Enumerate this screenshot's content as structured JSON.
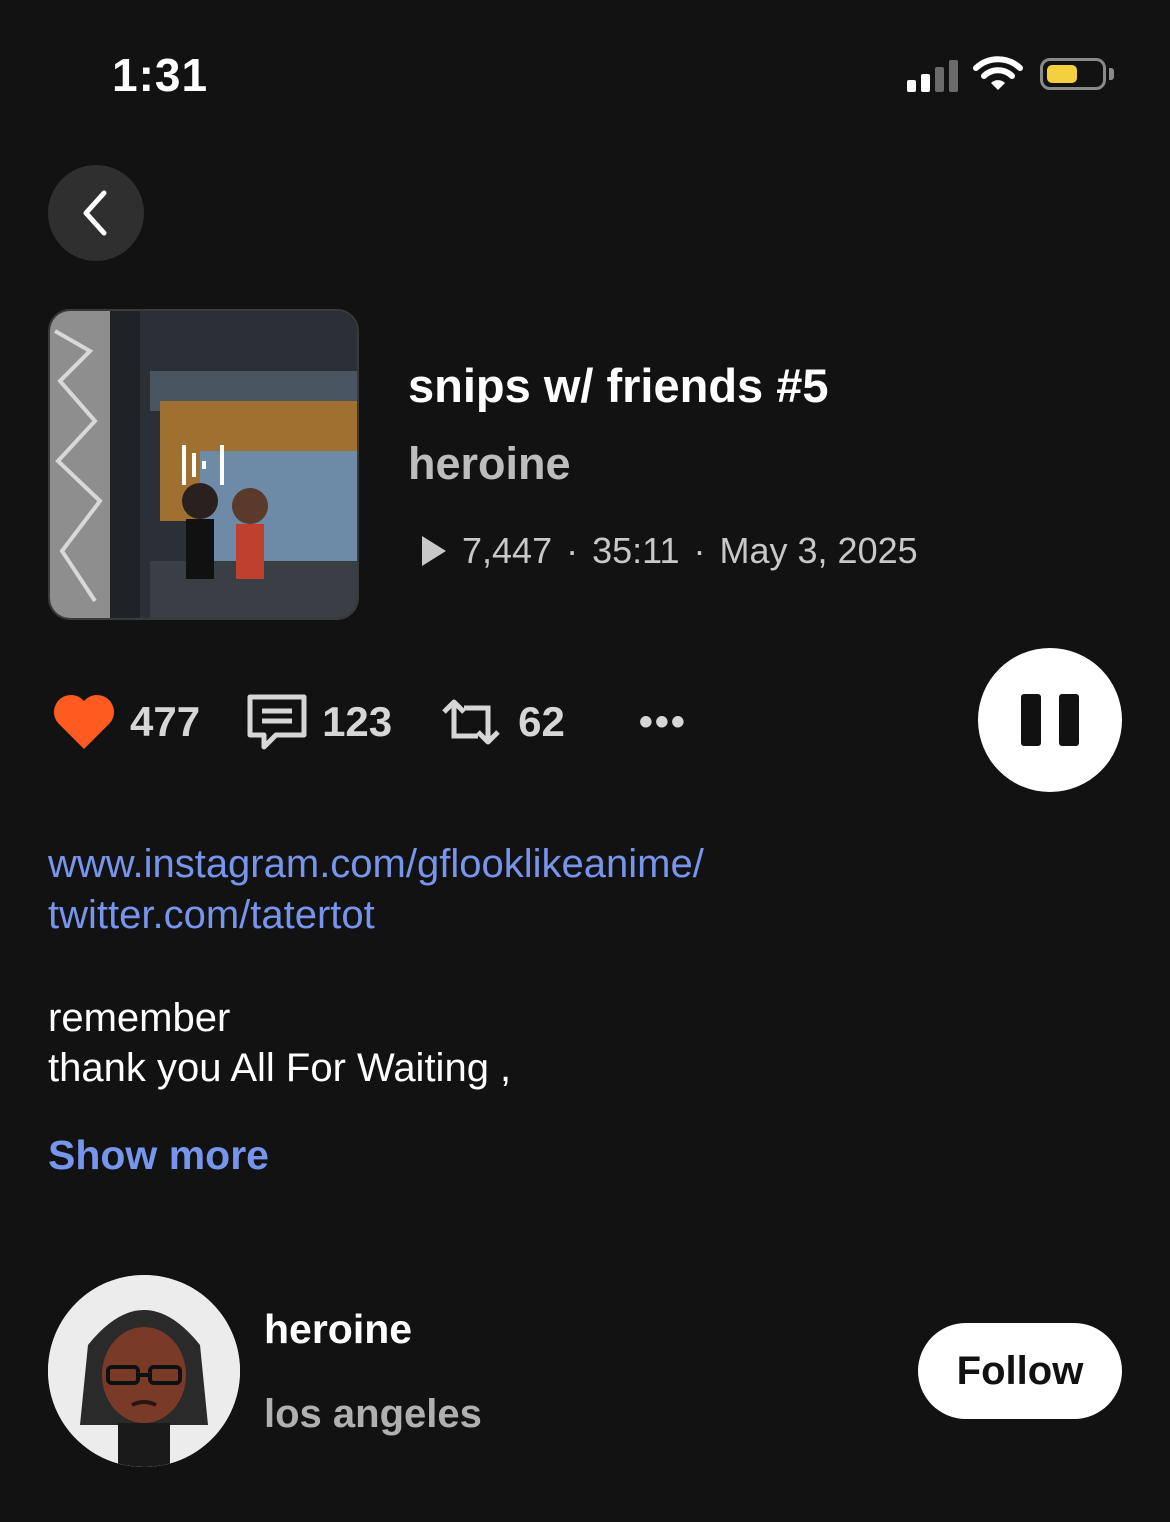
{
  "status_bar": {
    "time": "1:31",
    "signal_icon": "cellular-signal-icon",
    "wifi_icon": "wifi-icon",
    "battery_icon": "battery-icon",
    "battery_color": "#f4d03f"
  },
  "nav": {
    "back_icon": "chevron-left-icon"
  },
  "track": {
    "title": "snips w/ friends #5",
    "artist": "heroine",
    "plays": "7,447",
    "duration": "35:11",
    "date": "May 3, 2025",
    "separator": "·",
    "play_icon": "play-icon",
    "artwork_badge_icon": "waveform-icon"
  },
  "actions": {
    "likes": "477",
    "comments": "123",
    "reposts": "62",
    "like_icon": "heart-icon",
    "comment_icon": "comment-icon",
    "repost_icon": "repost-icon",
    "more_label": "•••",
    "like_color": "#ff5a1f"
  },
  "player": {
    "pause_icon": "pause-icon"
  },
  "description": {
    "links": [
      "www.instagram.com/gflooklikeanime/",
      "twitter.com/tatertot"
    ],
    "lines": [
      "remember",
      "thank you All For Waiting ,"
    ],
    "show_more": "Show more",
    "link_color": "#7795ec"
  },
  "artist_card": {
    "name": "heroine",
    "location": "los angeles",
    "follow_label": "Follow"
  }
}
